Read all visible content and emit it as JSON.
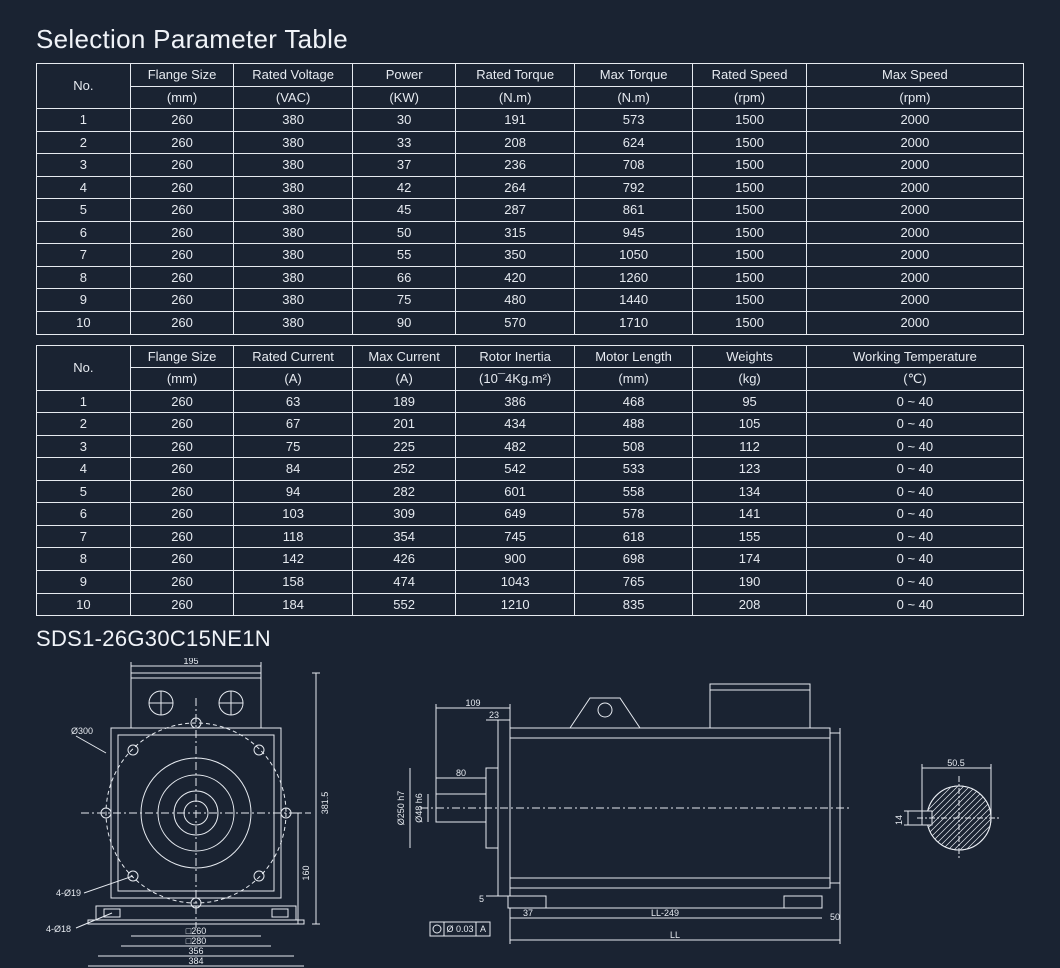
{
  "title": "Selection Parameter Table",
  "model": "SDS1-26G30C15NE1N",
  "table1": {
    "headers": {
      "no": "No.",
      "c1": {
        "t": "Flange Size",
        "u": "(mm)"
      },
      "c2": {
        "t": "Rated Voltage",
        "u": "(VAC)"
      },
      "c3": {
        "t": "Power",
        "u": "(KW)"
      },
      "c4": {
        "t": "Rated Torque",
        "u": "(N.m)"
      },
      "c5": {
        "t": "Max Torque",
        "u": "(N.m)"
      },
      "c6": {
        "t": "Rated Speed",
        "u": "(rpm)"
      },
      "c7": {
        "t": "Max Speed",
        "u": "(rpm)"
      }
    },
    "rows": [
      {
        "no": "1",
        "c1": "260",
        "c2": "380",
        "c3": "30",
        "c4": "191",
        "c5": "573",
        "c6": "1500",
        "c7": "2000"
      },
      {
        "no": "2",
        "c1": "260",
        "c2": "380",
        "c3": "33",
        "c4": "208",
        "c5": "624",
        "c6": "1500",
        "c7": "2000"
      },
      {
        "no": "3",
        "c1": "260",
        "c2": "380",
        "c3": "37",
        "c4": "236",
        "c5": "708",
        "c6": "1500",
        "c7": "2000"
      },
      {
        "no": "4",
        "c1": "260",
        "c2": "380",
        "c3": "42",
        "c4": "264",
        "c5": "792",
        "c6": "1500",
        "c7": "2000"
      },
      {
        "no": "5",
        "c1": "260",
        "c2": "380",
        "c3": "45",
        "c4": "287",
        "c5": "861",
        "c6": "1500",
        "c7": "2000"
      },
      {
        "no": "6",
        "c1": "260",
        "c2": "380",
        "c3": "50",
        "c4": "315",
        "c5": "945",
        "c6": "1500",
        "c7": "2000"
      },
      {
        "no": "7",
        "c1": "260",
        "c2": "380",
        "c3": "55",
        "c4": "350",
        "c5": "1050",
        "c6": "1500",
        "c7": "2000"
      },
      {
        "no": "8",
        "c1": "260",
        "c2": "380",
        "c3": "66",
        "c4": "420",
        "c5": "1260",
        "c6": "1500",
        "c7": "2000"
      },
      {
        "no": "9",
        "c1": "260",
        "c2": "380",
        "c3": "75",
        "c4": "480",
        "c5": "1440",
        "c6": "1500",
        "c7": "2000"
      },
      {
        "no": "10",
        "c1": "260",
        "c2": "380",
        "c3": "90",
        "c4": "570",
        "c5": "1710",
        "c6": "1500",
        "c7": "2000"
      }
    ]
  },
  "table2": {
    "headers": {
      "no": "No.",
      "c1": {
        "t": "Flange Size",
        "u": "(mm)"
      },
      "c2": {
        "t": "Rated Current",
        "u": "(A)"
      },
      "c3": {
        "t": "Max Current",
        "u": "(A)"
      },
      "c4": {
        "t": "Rotor Inertia",
        "u": "(10¯4Kg.m²)"
      },
      "c5": {
        "t": "Motor Length",
        "u": "(mm)"
      },
      "c6": {
        "t": "Weights",
        "u": "(kg)"
      },
      "c7": {
        "t": "Working Temperature",
        "u": "(℃)"
      }
    },
    "rows": [
      {
        "no": "1",
        "c1": "260",
        "c2": "63",
        "c3": "189",
        "c4": "386",
        "c5": "468",
        "c6": "95",
        "c7": "0 ~ 40"
      },
      {
        "no": "2",
        "c1": "260",
        "c2": "67",
        "c3": "201",
        "c4": "434",
        "c5": "488",
        "c6": "105",
        "c7": "0 ~ 40"
      },
      {
        "no": "3",
        "c1": "260",
        "c2": "75",
        "c3": "225",
        "c4": "482",
        "c5": "508",
        "c6": "112",
        "c7": "0 ~ 40"
      },
      {
        "no": "4",
        "c1": "260",
        "c2": "84",
        "c3": "252",
        "c4": "542",
        "c5": "533",
        "c6": "123",
        "c7": "0 ~ 40"
      },
      {
        "no": "5",
        "c1": "260",
        "c2": "94",
        "c3": "282",
        "c4": "601",
        "c5": "558",
        "c6": "134",
        "c7": "0 ~ 40"
      },
      {
        "no": "6",
        "c1": "260",
        "c2": "103",
        "c3": "309",
        "c4": "649",
        "c5": "578",
        "c6": "141",
        "c7": "0 ~ 40"
      },
      {
        "no": "7",
        "c1": "260",
        "c2": "118",
        "c3": "354",
        "c4": "745",
        "c5": "618",
        "c6": "155",
        "c7": "0 ~ 40"
      },
      {
        "no": "8",
        "c1": "260",
        "c2": "142",
        "c3": "426",
        "c4": "900",
        "c5": "698",
        "c6": "174",
        "c7": "0 ~ 40"
      },
      {
        "no": "9",
        "c1": "260",
        "c2": "158",
        "c3": "474",
        "c4": "1043",
        "c5": "765",
        "c6": "190",
        "c7": "0 ~ 40"
      },
      {
        "no": "10",
        "c1": "260",
        "c2": "184",
        "c3": "552",
        "c4": "1210",
        "c5": "835",
        "c6": "208",
        "c7": "0 ~ 40"
      }
    ]
  },
  "drawing": {
    "front": {
      "w195": "195",
      "d300": "Ø300",
      "h381_5": "381.5",
      "h160": "160",
      "holes_4_19": "4-Ø19",
      "holes_4_18": "4-Ø18",
      "sq260": "□260",
      "sq280": "□280",
      "w356": "356",
      "w384": "384"
    },
    "side": {
      "w109": "109",
      "w23": "23",
      "w80": "80",
      "d250h7": "Ø250 h7",
      "d48h6": "Ø48 h6",
      "w5": "5",
      "w37": "37",
      "gd": "Ø 0.03",
      "gd_datum": "A",
      "ll249": "LL-249",
      "w50": "50",
      "ll": "LL"
    },
    "key": {
      "w50_5": "50.5",
      "h14": "14"
    }
  }
}
